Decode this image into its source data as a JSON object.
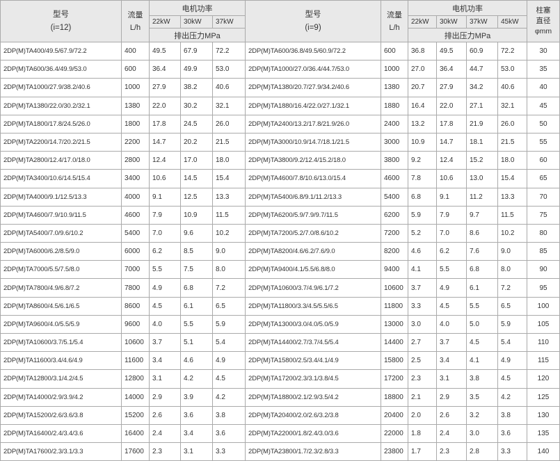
{
  "left_group": {
    "model_label": "型号",
    "ratio_label": "(i=12)",
    "flow_label": "流量",
    "flow_unit": "L/h",
    "power_label": "电机功率",
    "powers": [
      "22kW",
      "30kW",
      "37kW"
    ],
    "pressure_label": "排出压力MPa"
  },
  "right_group": {
    "model_label": "型号",
    "ratio_label": "(i=9)",
    "flow_label": "流量",
    "flow_unit": "L/h",
    "power_label": "电机功率",
    "powers": [
      "22kW",
      "30kW",
      "37kW",
      "45kW"
    ],
    "pressure_label": "排出压力MPa"
  },
  "diameter_label_1": "柱塞",
  "diameter_label_2": "直径",
  "diameter_unit": "φmm",
  "rows": [
    {
      "lm": "2DP(M)TA400/49.5/67.9/72.2",
      "lf": "400",
      "l22": "49.5",
      "l30": "67.9",
      "l37": "72.2",
      "rm": "2DP(M)TA600/36.8/49.5/60.9/72.2",
      "rf": "600",
      "r22": "36.8",
      "r30": "49.5",
      "r37": "60.9",
      "r45": "72.2",
      "d": "30"
    },
    {
      "lm": "2DP(M)TA600/36.4/49.9/53.0",
      "lf": "600",
      "l22": "36.4",
      "l30": "49.9",
      "l37": "53.0",
      "rm": "2DP(M)TA1000/27.0/36.4/44.7/53.0",
      "rf": "1000",
      "r22": "27.0",
      "r30": "36.4",
      "r37": "44.7",
      "r45": "53.0",
      "d": "35"
    },
    {
      "lm": "2DP(M)TA1000/27.9/38.2/40.6",
      "lf": "1000",
      "l22": "27.9",
      "l30": "38.2",
      "l37": "40.6",
      "rm": "2DP(M)TA1380/20.7/27.9/34.2/40.6",
      "rf": "1380",
      "r22": "20.7",
      "r30": "27.9",
      "r37": "34.2",
      "r45": "40.6",
      "d": "40"
    },
    {
      "lm": "2DP(M)TA1380/22.0/30.2/32.1",
      "lf": "1380",
      "l22": "22.0",
      "l30": "30.2",
      "l37": "32.1",
      "rm": "2DP(M)TA1880/16.4/22.0/27.1/32.1",
      "rf": "1880",
      "r22": "16.4",
      "r30": "22.0",
      "r37": "27.1",
      "r45": "32.1",
      "d": "45"
    },
    {
      "lm": "2DP(M)TA1800/17.8/24.5/26.0",
      "lf": "1800",
      "l22": "17.8",
      "l30": "24.5",
      "l37": "26.0",
      "rm": "2DP(M)TA2400/13.2/17.8/21.9/26.0",
      "rf": "2400",
      "r22": "13.2",
      "r30": "17.8",
      "r37": "21.9",
      "r45": "26.0",
      "d": "50"
    },
    {
      "lm": "2DP(M)TA2200/14.7/20.2/21.5",
      "lf": "2200",
      "l22": "14.7",
      "l30": "20.2",
      "l37": "21.5",
      "rm": "2DP(M)TA3000/10.9/14.7/18.1/21.5",
      "rf": "3000",
      "r22": "10.9",
      "r30": "14.7",
      "r37": "18.1",
      "r45": "21.5",
      "d": "55"
    },
    {
      "lm": "2DP(M)TA2800/12.4/17.0/18.0",
      "lf": "2800",
      "l22": "12.4",
      "l30": "17.0",
      "l37": "18.0",
      "rm": "2DP(M)TA3800/9.2/12.4/15.2/18.0",
      "rf": "3800",
      "r22": "9.2",
      "r30": "12.4",
      "r37": "15.2",
      "r45": "18.0",
      "d": "60"
    },
    {
      "lm": "2DP(M)TA3400/10.6/14.5/15.4",
      "lf": "3400",
      "l22": "10.6",
      "l30": "14.5",
      "l37": "15.4",
      "rm": "2DP(M)TA4600/7.8/10.6/13.0/15.4",
      "rf": "4600",
      "r22": "7.8",
      "r30": "10.6",
      "r37": "13.0",
      "r45": "15.4",
      "d": "65"
    },
    {
      "lm": "2DP(M)TA4000/9.1/12.5/13.3",
      "lf": "4000",
      "l22": "9.1",
      "l30": "12.5",
      "l37": "13.3",
      "rm": "2DP(M)TA5400/6.8/9.1/11.2/13.3",
      "rf": "5400",
      "r22": "6.8",
      "r30": "9.1",
      "r37": "11.2",
      "r45": "13.3",
      "d": "70"
    },
    {
      "lm": "2DP(M)TA4600/7.9/10.9/11.5",
      "lf": "4600",
      "l22": "7.9",
      "l30": "10.9",
      "l37": "11.5",
      "rm": "2DP(M)TA6200/5.9/7.9/9.7/11.5",
      "rf": "6200",
      "r22": "5.9",
      "r30": "7.9",
      "r37": "9.7",
      "r45": "11.5",
      "d": "75"
    },
    {
      "lm": "2DP(M)TA5400/7.0/9.6/10.2",
      "lf": "5400",
      "l22": "7.0",
      "l30": "9.6",
      "l37": "10.2",
      "rm": "2DP(M)TA7200/5.2/7.0/8.6/10.2",
      "rf": "7200",
      "r22": "5.2",
      "r30": "7.0",
      "r37": "8.6",
      "r45": "10.2",
      "d": "80"
    },
    {
      "lm": "2DP(M)TA6000/6.2/8.5/9.0",
      "lf": "6000",
      "l22": "6.2",
      "l30": "8.5",
      "l37": "9.0",
      "rm": "2DP(M)TA8200/4.6/6.2/7.6/9.0",
      "rf": "8200",
      "r22": "4.6",
      "r30": "6.2",
      "r37": "7.6",
      "r45": "9.0",
      "d": "85"
    },
    {
      "lm": "2DP(M)TA7000/5.5/7.5/8.0",
      "lf": "7000",
      "l22": "5.5",
      "l30": "7.5",
      "l37": "8.0",
      "rm": "2DP(M)TA9400/4.1/5.5/6.8/8.0",
      "rf": "9400",
      "r22": "4.1",
      "r30": "5.5",
      "r37": "6.8",
      "r45": "8.0",
      "d": "90"
    },
    {
      "lm": "2DP(M)TA7800/4.9/6.8/7.2",
      "lf": "7800",
      "l22": "4.9",
      "l30": "6.8",
      "l37": "7.2",
      "rm": "2DP(M)TA10600/3.7/4.9/6.1/7.2",
      "rf": "10600",
      "r22": "3.7",
      "r30": "4.9",
      "r37": "6.1",
      "r45": "7.2",
      "d": "95"
    },
    {
      "lm": "2DP(M)TA8600/4.5/6.1/6.5",
      "lf": "8600",
      "l22": "4.5",
      "l30": "6.1",
      "l37": "6.5",
      "rm": "2DP(M)TA11800/3.3/4.5/5.5/6.5",
      "rf": "11800",
      "r22": "3.3",
      "r30": "4.5",
      "r37": "5.5",
      "r45": "6.5",
      "d": "100"
    },
    {
      "lm": "2DP(M)TA9600/4.0/5.5/5.9",
      "lf": "9600",
      "l22": "4.0",
      "l30": "5.5",
      "l37": "5.9",
      "rm": "2DP(M)TA13000/3.0/4.0/5.0/5.9",
      "rf": "13000",
      "r22": "3.0",
      "r30": "4.0",
      "r37": "5.0",
      "r45": "5.9",
      "d": "105"
    },
    {
      "lm": "2DP(M)TA10600/3.7/5.1/5.4",
      "lf": "10600",
      "l22": "3.7",
      "l30": "5.1",
      "l37": "5.4",
      "rm": "2DP(M)TA14400/2.7/3.7/4.5/5.4",
      "rf": "14400",
      "r22": "2.7",
      "r30": "3.7",
      "r37": "4.5",
      "r45": "5.4",
      "d": "110"
    },
    {
      "lm": "2DP(M)TA11600/3.4/4.6/4.9",
      "lf": "11600",
      "l22": "3.4",
      "l30": "4.6",
      "l37": "4.9",
      "rm": "2DP(M)TA15800/2.5/3.4/4.1/4.9",
      "rf": "15800",
      "r22": "2.5",
      "r30": "3.4",
      "r37": "4.1",
      "r45": "4.9",
      "d": "115"
    },
    {
      "lm": "2DP(M)TA12800/3.1/4.2/4.5",
      "lf": "12800",
      "l22": "3.1",
      "l30": "4.2",
      "l37": "4.5",
      "rm": "2DP(M)TA17200/2.3/3.1/3.8/4.5",
      "rf": "17200",
      "r22": "2.3",
      "r30": "3.1",
      "r37": "3.8",
      "r45": "4.5",
      "d": "120"
    },
    {
      "lm": "2DP(M)TA14000/2.9/3.9/4.2",
      "lf": "14000",
      "l22": "2.9",
      "l30": "3.9",
      "l37": "4.2",
      "rm": "2DP(M)TA18800/2.1/2.9/3.5/4.2",
      "rf": "18800",
      "r22": "2.1",
      "r30": "2.9",
      "r37": "3.5",
      "r45": "4.2",
      "d": "125"
    },
    {
      "lm": "2DP(M)TA15200/2.6/3.6/3.8",
      "lf": "15200",
      "l22": "2.6",
      "l30": "3.6",
      "l37": "3.8",
      "rm": "2DP(M)TA20400/2.0/2.6/3.2/3.8",
      "rf": "20400",
      "r22": "2.0",
      "r30": "2.6",
      "r37": "3.2",
      "r45": "3.8",
      "d": "130"
    },
    {
      "lm": "2DP(M)TA16400/2.4/3.4/3.6",
      "lf": "16400",
      "l22": "2.4",
      "l30": "3.4",
      "l37": "3.6",
      "rm": "2DP(M)TA22000/1.8/2.4/3.0/3.6",
      "rf": "22000",
      "r22": "1.8",
      "r30": "2.4",
      "r37": "3.0",
      "r45": "3.6",
      "d": "135"
    },
    {
      "lm": "2DP(M)TA17600/2.3/3.1/3.3",
      "lf": "17600",
      "l22": "2.3",
      "l30": "3.1",
      "l37": "3.3",
      "rm": "2DP(M)TA23800/1.7/2.3/2.8/3.3",
      "rf": "23800",
      "r22": "1.7",
      "r30": "2.3",
      "r37": "2.8",
      "r45": "3.3",
      "d": "140"
    }
  ]
}
